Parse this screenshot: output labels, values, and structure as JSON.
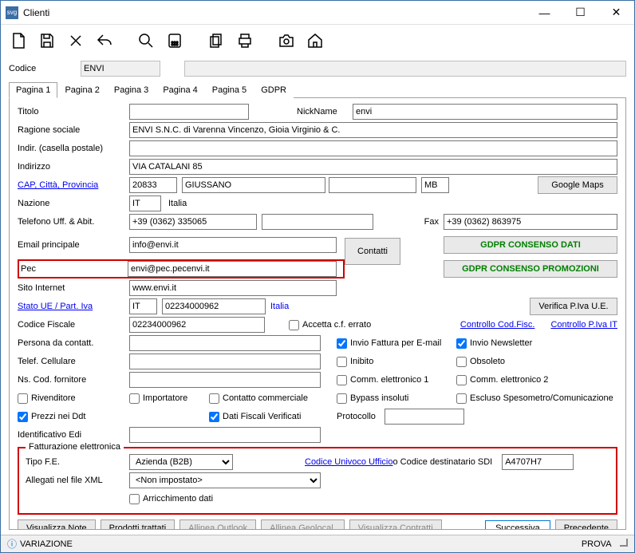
{
  "window": {
    "title": "Clienti"
  },
  "sysbuttons": {
    "min": "—",
    "max": "☐",
    "close": "✕"
  },
  "toolbar_icons": [
    "new",
    "save",
    "delete",
    "undo",
    "search",
    "calc",
    "copy",
    "print",
    "camera",
    "home"
  ],
  "codice": {
    "label": "Codice",
    "value": "ENVI",
    "desc": ""
  },
  "tabs": [
    "Pagina 1",
    "Pagina 2",
    "Pagina 3",
    "Pagina 4",
    "Pagina 5",
    "GDPR"
  ],
  "active_tab": 0,
  "fields": {
    "titolo": {
      "label": "Titolo",
      "value": ""
    },
    "nickname": {
      "label": "NickName",
      "value": "envi"
    },
    "ragione_sociale": {
      "label": "Ragione sociale",
      "value": "ENVI S.N.C. di Varenna Vincenzo, Gioia Virginio & C."
    },
    "indir_postale": {
      "label": "Indir. (casella postale)",
      "value": ""
    },
    "indirizzo": {
      "label": "Indirizzo",
      "value": "VIA CATALANI 85"
    },
    "cap_citta": {
      "label": "CAP, Città, Provincia",
      "cap": "20833",
      "citta": "GIUSSANO",
      "extra": "",
      "prov": "MB"
    },
    "google_maps": "Google Maps",
    "nazione": {
      "label": "Nazione",
      "code": "IT",
      "name": "Italia"
    },
    "telefono": {
      "label": "Telefono Uff. & Abit.",
      "uff": "+39 (0362) 335065",
      "abit": ""
    },
    "fax": {
      "label": "Fax",
      "value": "+39 (0362) 863975"
    },
    "email": {
      "label": "Email principale",
      "value": "info@envi.it"
    },
    "contatti_btn": "Contatti",
    "gdpr_dati": "GDPR CONSENSO DATI",
    "gdpr_promo": "GDPR CONSENSO PROMOZIONI",
    "pec": {
      "label": "Pec",
      "value": "envi@pec.pecenvi.it"
    },
    "sito": {
      "label": "Sito Internet",
      "value": "www.envi.it"
    },
    "stato_ue": {
      "label": "Stato UE / Part. Iva",
      "code": "IT",
      "piva": "02234000962",
      "nazione": "Italia"
    },
    "verifica_piva": "Verifica P.Iva U.E.",
    "codice_fiscale": {
      "label": "Codice Fiscale",
      "value": "02234000962"
    },
    "accetta_cf": "Accetta c.f. errato",
    "controllo_cod_fisc": "Controllo Cod.Fisc.",
    "controllo_piva_it": "Controllo P.Iva IT",
    "persona_contatt": {
      "label": "Persona da contatt.",
      "value": ""
    },
    "invio_fattura": "Invio Fattura per E-mail",
    "invio_newsletter": "Invio Newsletter",
    "telef_cellulare": {
      "label": "Telef. Cellulare",
      "value": ""
    },
    "inibito": "Inibito",
    "obsoleto": "Obsoleto",
    "ns_cod_fornitore": {
      "label": "Ns. Cod. fornitore",
      "value": ""
    },
    "comm_elettr1": "Comm. elettronico 1",
    "comm_elettr2": "Comm. elettronico 2",
    "rivenditore": "Rivenditore",
    "importatore": "Importatore",
    "contatto_comm": "Contatto commerciale",
    "bypass_insoluti": "Bypass insoluti",
    "escluso_speso": "Escluso Spesometro/Comunicazione",
    "prezzi_ddt": "Prezzi nei Ddt",
    "dati_fiscali": "Dati Fiscali Verificati",
    "protocollo": {
      "label": "Protocollo",
      "value": ""
    },
    "identificativo_edi": {
      "label": "Identificativo Edi",
      "value": ""
    }
  },
  "fatturazione": {
    "legend": "Fatturazione elettronica",
    "tipo_fe": {
      "label": "Tipo F.E.",
      "value": "Azienda (B2B)"
    },
    "codice_univoco_link": "Codice Univoco Ufficio",
    "codice_dest_text": " o Codice destinatario SDI",
    "codice_dest_value": "A4707H7",
    "allegati": {
      "label": "Allegati nel file XML",
      "value": "<Non impostato>"
    },
    "arricchimento": "Arricchimento dati"
  },
  "bottom": {
    "visualizza_note": "Visualizza Note",
    "prodotti": "Prodotti trattati",
    "allinea_outlook": "Allinea Outlook",
    "allinea_geo": "Allinea Geolocal.",
    "visualizza_contratti": "Visualizza Contratti",
    "successiva": "Successiva",
    "precedente": "Precedente"
  },
  "status": {
    "left": "VARIAZIONE",
    "right": "PROVA"
  }
}
